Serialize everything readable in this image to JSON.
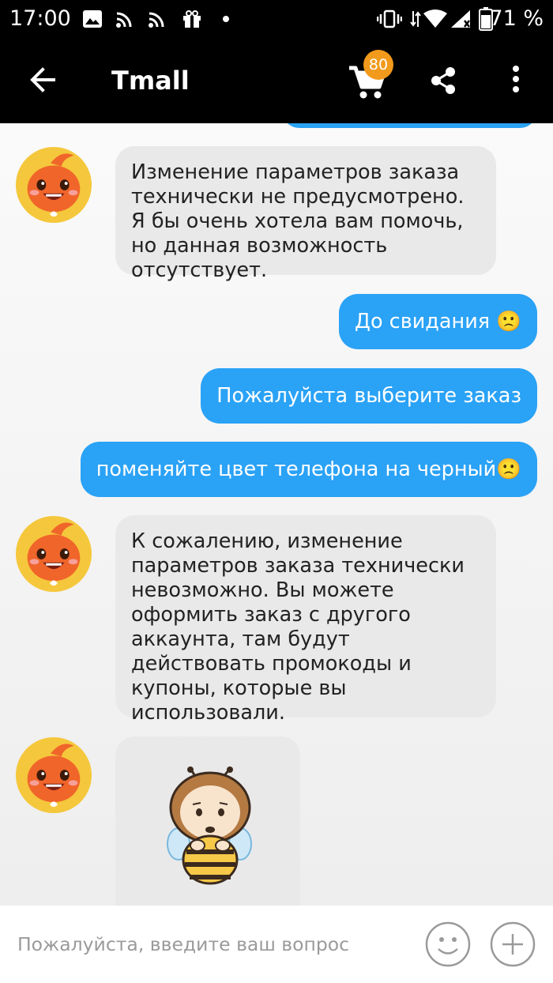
{
  "status_bar": {
    "time": "17:00",
    "battery_percent": "71 %",
    "icons": [
      "image-icon",
      "cast-icon",
      "cast-icon",
      "gift-icon",
      "dot-icon",
      "vibrate-icon",
      "wifi-icon",
      "signal-icon",
      "battery-icon"
    ]
  },
  "app_bar": {
    "title": "Tmall",
    "cart_badge": "80",
    "icons": [
      "back-arrow-icon",
      "cart-icon",
      "share-icon",
      "more-vert-icon"
    ]
  },
  "messages": [
    {
      "from": "agent",
      "text": "Изменение параметров заказа технически не предусмотрено. Я бы очень хотела вам помочь, но данная возможность отсутствует."
    },
    {
      "from": "user",
      "text": "До свидания 🙁"
    },
    {
      "from": "user",
      "text": "Пожалуйста выберите заказ"
    },
    {
      "from": "user",
      "text": "поменяйте цвет телефона на черный🙁"
    },
    {
      "from": "agent",
      "text": "К сожалению, изменение параметров заказа технически невозможно. Вы можете оформить заказ с другого аккаунта, там будут действовать промокоды и купоны, которые вы использовали."
    },
    {
      "from": "agent",
      "type": "sticker",
      "sticker": "sad-bee-sticker"
    }
  ],
  "input": {
    "placeholder": "Пожалуйста, введите ваш вопрос",
    "icons": [
      "emoji-icon",
      "add-icon"
    ]
  },
  "colors": {
    "user_bubble": "#2aa2f6",
    "agent_bubble": "#e9e9ea",
    "badge": "#f29a1b",
    "avatar_bg": "#f5c73c",
    "mascot": "#f0652a"
  }
}
